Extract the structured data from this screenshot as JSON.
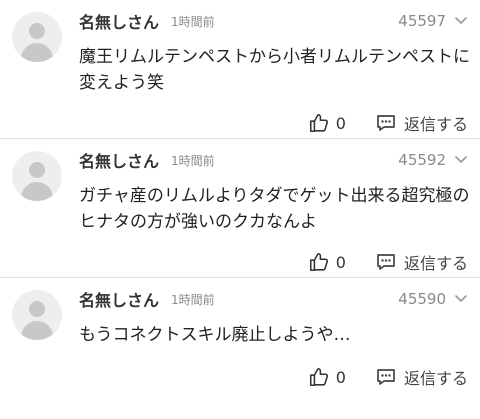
{
  "comments": [
    {
      "name": "名無しさん",
      "time": "1時間前",
      "number": "45597",
      "text": "魔王リムルテンペストから小者リムルテンペストに変えよう笑",
      "likes": "0",
      "reply_label": "返信する"
    },
    {
      "name": "名無しさん",
      "time": "1時間前",
      "number": "45592",
      "text": "ガチャ産のリムルよりタダでゲット出来る超究極のヒナタの方が強いのクカなんよ",
      "likes": "0",
      "reply_label": "返信する"
    },
    {
      "name": "名無しさん",
      "time": "1時間前",
      "number": "45590",
      "text": "もうコネクトスキル廃止しようや…",
      "likes": "0",
      "reply_label": "返信する"
    }
  ]
}
